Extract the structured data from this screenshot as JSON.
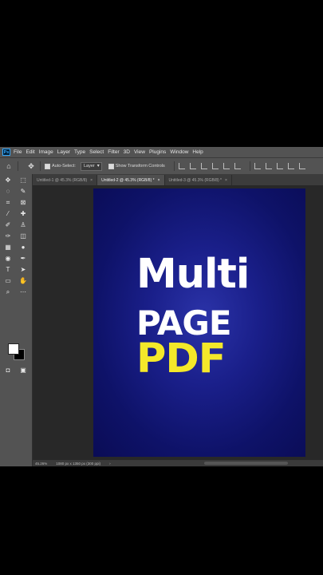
{
  "menubar": {
    "logo": "Ps",
    "items": [
      "File",
      "Edit",
      "Image",
      "Layer",
      "Type",
      "Select",
      "Filter",
      "3D",
      "View",
      "Plugins",
      "Window",
      "Help"
    ]
  },
  "optionsbar": {
    "auto_select_label": "Auto-Select:",
    "auto_select_target": "Layer",
    "transform_label": "Show Transform Controls"
  },
  "tabs": [
    {
      "label": "Untitled-1 @ 45.3% (RGB/8)",
      "close": "×"
    },
    {
      "label": "Untitled-2 @ 45.3% (RGB/8) *",
      "close": "×"
    },
    {
      "label": "Untitled-3 @ 45.3% (RGB/8) *",
      "close": "×"
    }
  ],
  "document": {
    "line1": "Multi",
    "line2": "PAGE",
    "line3": "PDF",
    "text_color_primary": "#ffffff",
    "text_color_accent": "#f4e82a",
    "background_color": "#141a7a"
  },
  "status": {
    "zoom": "45.26%",
    "doc_size": "1080 px x 1350 px (300 ppi)",
    "arrow": "›"
  }
}
